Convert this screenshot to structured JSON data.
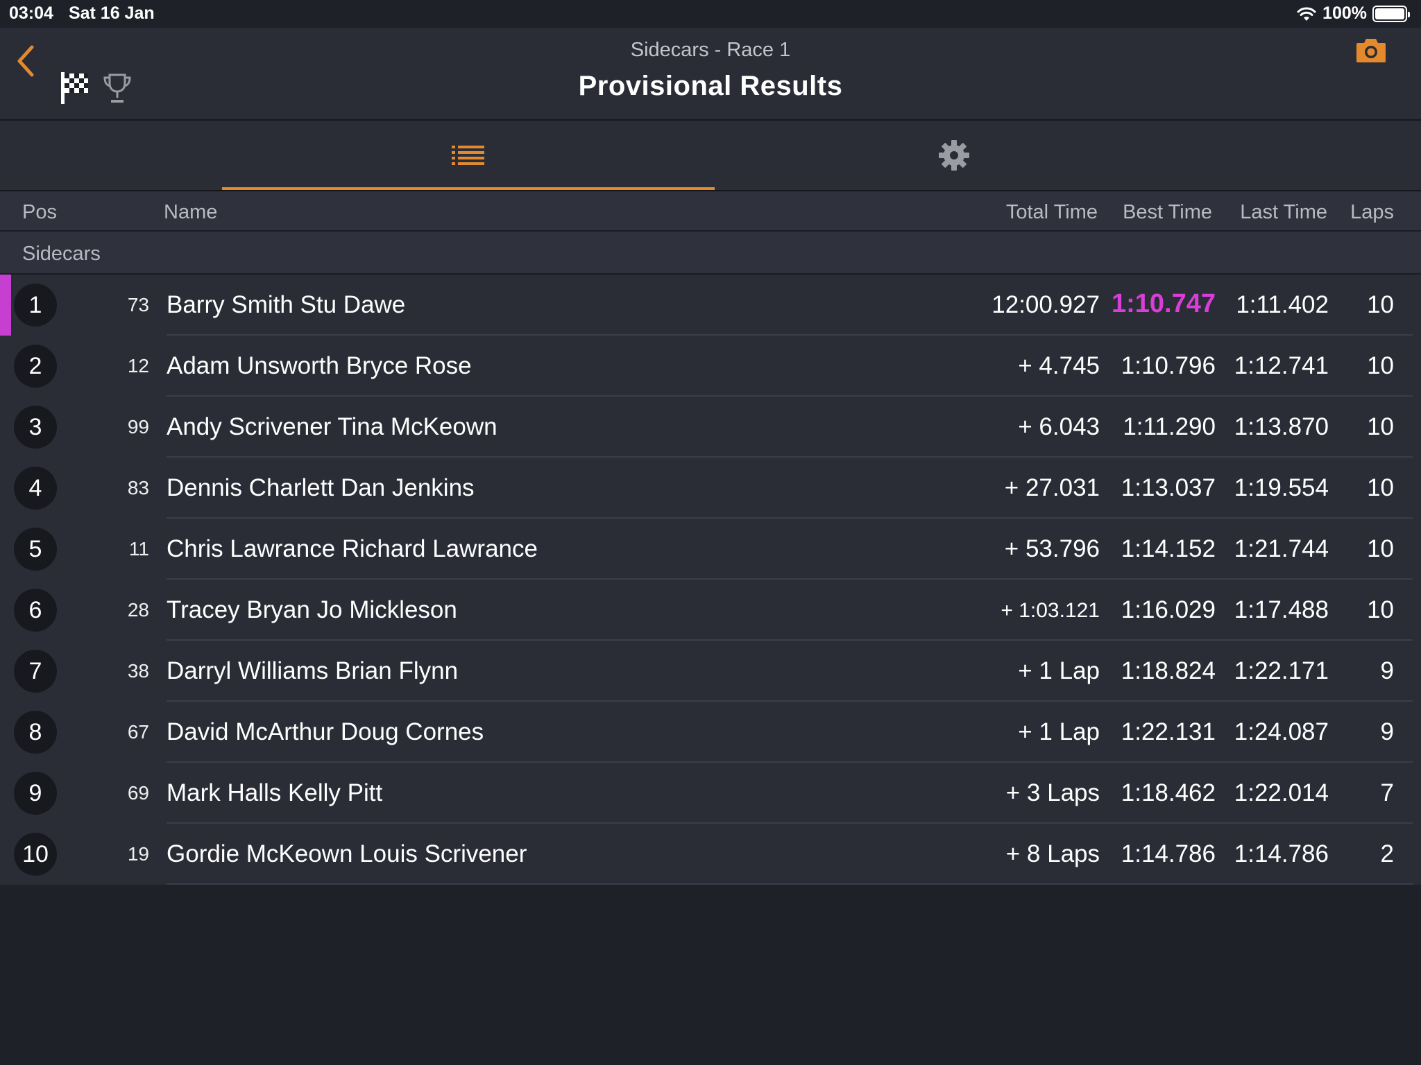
{
  "status_bar": {
    "time": "03:04",
    "date": "Sat 16 Jan",
    "battery": "100%"
  },
  "header": {
    "subtitle": "Sidecars - Race 1",
    "title": "Provisional Results"
  },
  "colors": {
    "accent": "#e5892d",
    "fastest_lap": "#d93ed8",
    "leader_marker": "#c63fd0"
  },
  "columns": {
    "pos": "Pos",
    "name": "Name",
    "total": "Total Time",
    "best": "Best Time",
    "last": "Last Time",
    "laps": "Laps"
  },
  "group_label": "Sidecars",
  "results": [
    {
      "pos": "1",
      "num": "73",
      "name": "Barry Smith Stu Dawe",
      "total": "12:00.927",
      "best": "1:10.747",
      "last": "1:11.402",
      "laps": "10",
      "fastest": true
    },
    {
      "pos": "2",
      "num": "12",
      "name": "Adam Unsworth Bryce Rose",
      "total": "+ 4.745",
      "best": "1:10.796",
      "last": "1:12.741",
      "laps": "10"
    },
    {
      "pos": "3",
      "num": "99",
      "name": "Andy Scrivener Tina McKeown",
      "total": "+ 6.043",
      "best": "1:11.290",
      "last": "1:13.870",
      "laps": "10"
    },
    {
      "pos": "4",
      "num": "83",
      "name": "Dennis Charlett Dan Jenkins",
      "total": "+ 27.031",
      "best": "1:13.037",
      "last": "1:19.554",
      "laps": "10"
    },
    {
      "pos": "5",
      "num": "11",
      "name": "Chris Lawrance Richard Lawrance",
      "total": "+ 53.796",
      "best": "1:14.152",
      "last": "1:21.744",
      "laps": "10"
    },
    {
      "pos": "6",
      "num": "28",
      "name": "Tracey Bryan Jo Mickleson",
      "total": "+ 1:03.121",
      "best": "1:16.029",
      "last": "1:17.488",
      "laps": "10"
    },
    {
      "pos": "7",
      "num": "38",
      "name": "Darryl Williams Brian Flynn",
      "total": "+ 1 Lap",
      "best": "1:18.824",
      "last": "1:22.171",
      "laps": "9"
    },
    {
      "pos": "8",
      "num": "67",
      "name": "David McArthur Doug Cornes",
      "total": "+ 1 Lap",
      "best": "1:22.131",
      "last": "1:24.087",
      "laps": "9"
    },
    {
      "pos": "9",
      "num": "69",
      "name": "Mark Halls Kelly Pitt",
      "total": "+ 3 Laps",
      "best": "1:18.462",
      "last": "1:22.014",
      "laps": "7"
    },
    {
      "pos": "10",
      "num": "19",
      "name": "Gordie McKeown Louis Scrivener",
      "total": "+ 8 Laps",
      "best": "1:14.786",
      "last": "1:14.786",
      "laps": "2"
    }
  ]
}
